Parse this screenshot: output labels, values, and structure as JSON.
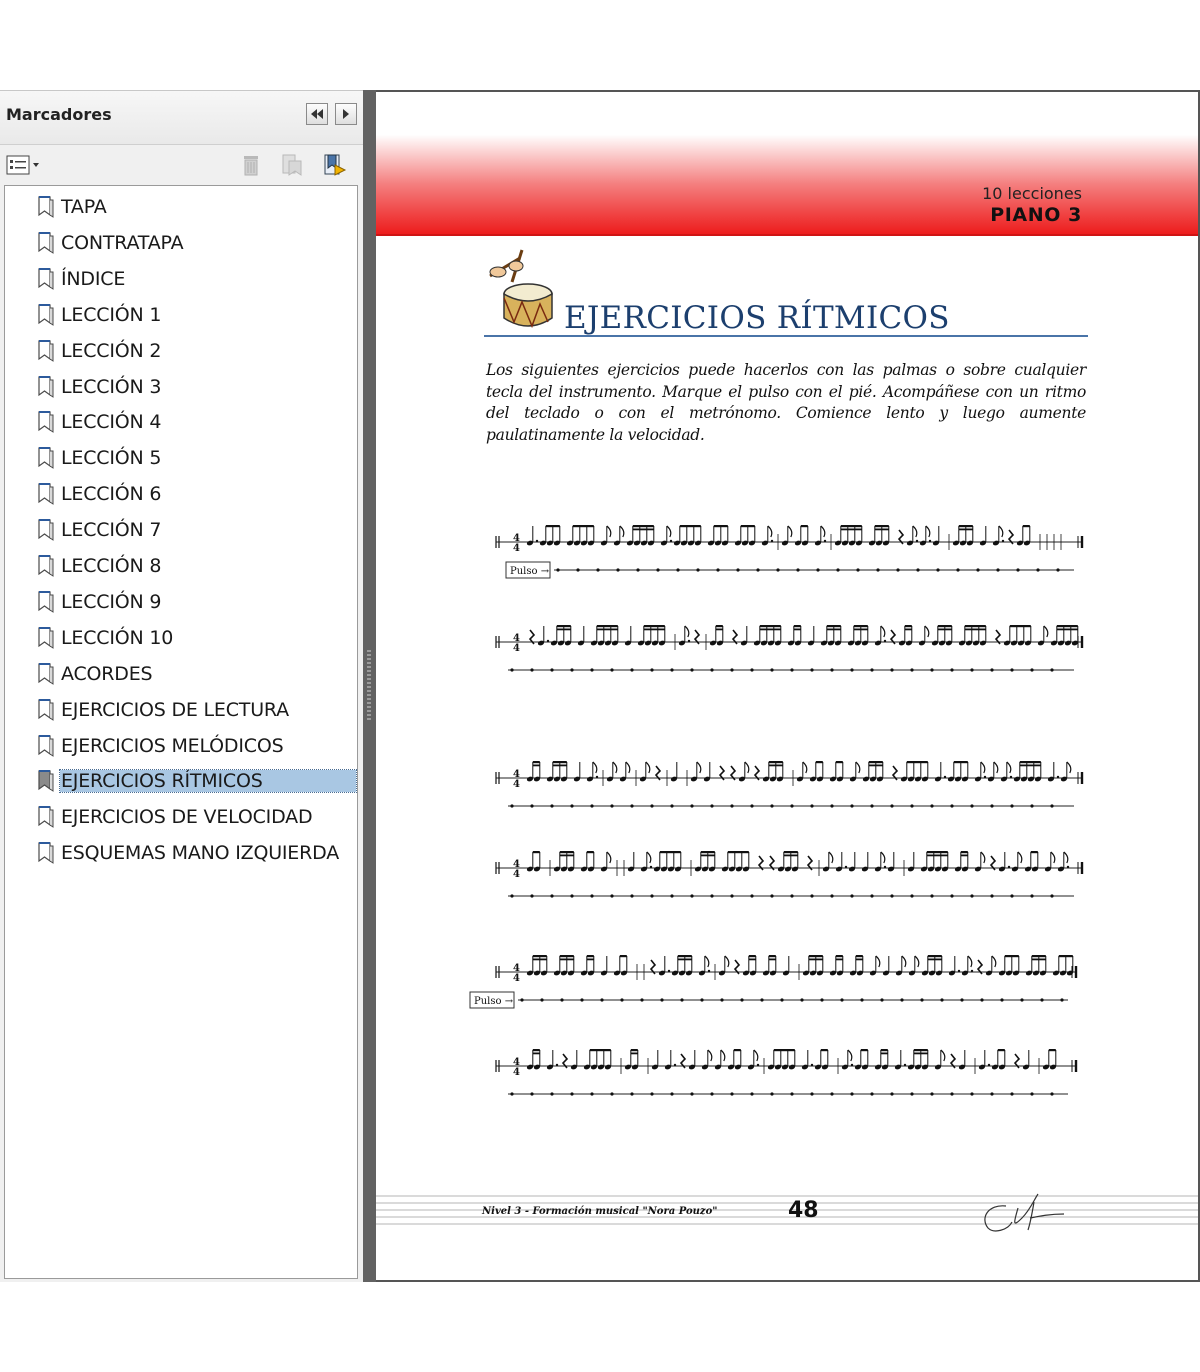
{
  "panel": {
    "title": "Marcadores",
    "bookmarks": [
      {
        "label": "TAPA"
      },
      {
        "label": "CONTRATAPA"
      },
      {
        "label": "ÍNDICE"
      },
      {
        "label": "LECCIÓN 1"
      },
      {
        "label": "LECCIÓN 2"
      },
      {
        "label": "LECCIÓN 3"
      },
      {
        "label": "LECCIÓN 4"
      },
      {
        "label": "LECCIÓN 5"
      },
      {
        "label": "LECCIÓN 6"
      },
      {
        "label": "LECCIÓN 7"
      },
      {
        "label": "LECCIÓN 8"
      },
      {
        "label": "LECCIÓN 9"
      },
      {
        "label": "LECCIÓN 10"
      },
      {
        "label": "ACORDES"
      },
      {
        "label": "EJERCICIOS DE LECTURA"
      },
      {
        "label": "EJERCICIOS MELÓDICOS"
      },
      {
        "label": "EJERCICIOS RÍTMICOS",
        "selected": true
      },
      {
        "label": "EJERCICIOS DE VELOCIDAD"
      },
      {
        "label": "ESQUEMAS MANO IZQUIERDA"
      }
    ],
    "icons": [
      "collapse-panel-icon",
      "expand-panel-icon",
      "options-menu-icon",
      "delete-bookmark-icon",
      "new-bookmark-from-selection-icon",
      "new-bookmark-icon",
      "bookmark-icon"
    ]
  },
  "page": {
    "course_sub": "10 lecciones",
    "course_title": "PIANO 3",
    "section_title": "EJERCICIOS RÍTMICOS",
    "intro": "Los siguientes ejercicios puede hacerlos con las palmas o sobre cualquier tecla del instrumento. Marque el pulso con el pié. Acompáñese con un ritmo del teclado o con el metrónomo. Comience lento y luego aumente paulatinamente la velocidad.",
    "pulse_label": "Pulso →",
    "time_signature": "4/4",
    "footer_text": "Nivel 3 - Formación musical \"Nora Pouzo\"",
    "page_number": "48",
    "accent_color": "#ed1c1c",
    "title_color": "#1c3f6e",
    "exercise_rows": 6,
    "icons": [
      "drum-icon",
      "signature-icon"
    ]
  }
}
